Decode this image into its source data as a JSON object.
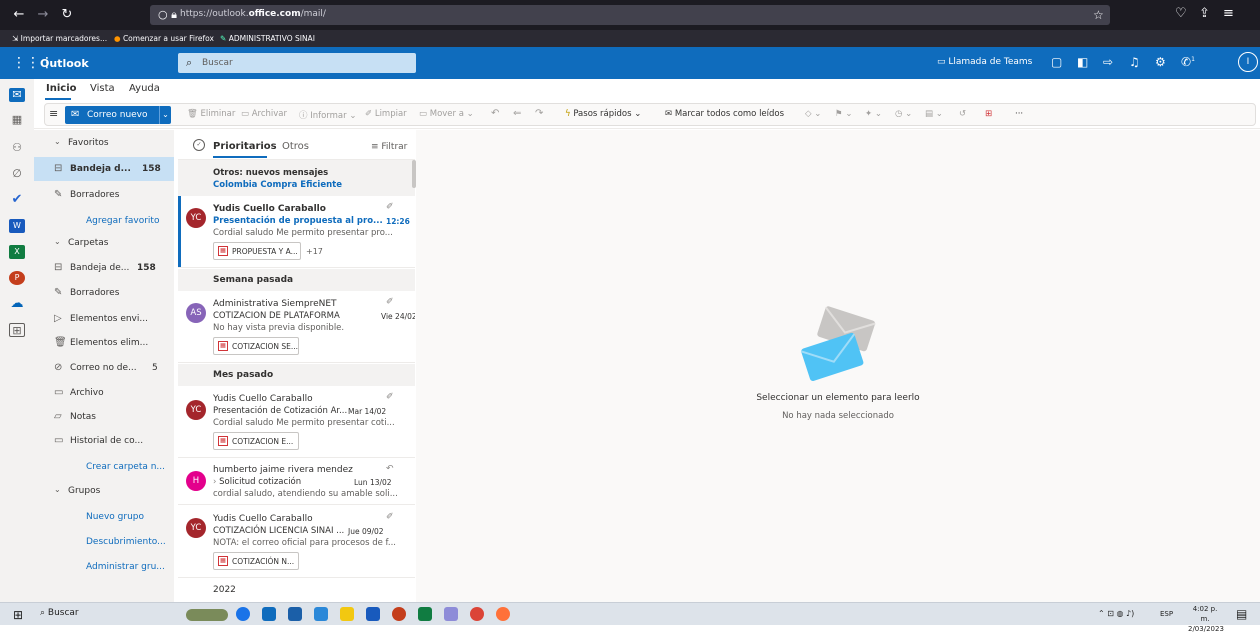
{
  "browser": {
    "url_host_prefix": "https://outlook.",
    "url_host_bold": "office.com",
    "url_path": "/mail/",
    "bookmarks": [
      "Importar marcadores...",
      "Comenzar a usar Firefox",
      "ADMINISTRATIVO SINAI"
    ]
  },
  "header": {
    "app_name": "Outlook",
    "search_placeholder": "Buscar",
    "teams_label": "Llamada de Teams",
    "user_initial": "I",
    "notification_badge": "1"
  },
  "ribbon": {
    "tabs": [
      "Inicio",
      "Vista",
      "Ayuda"
    ],
    "new_mail": "Correo nuevo",
    "actions": {
      "delete": "Eliminar",
      "archive": "Archivar",
      "report": "Informar",
      "sweep": "Limpiar",
      "move": "Mover a",
      "quick_steps": "Pasos rápidos",
      "mark_all_read": "Marcar todos como leídos"
    }
  },
  "folders": {
    "favorites_label": "Favoritos",
    "favorites": [
      {
        "label": "Bandeja d...",
        "count": "158"
      },
      {
        "label": "Borradores"
      }
    ],
    "add_favorite": "Agregar favorito",
    "folders_label": "Carpetas",
    "items": [
      {
        "label": "Bandeja de...",
        "count": "158"
      },
      {
        "label": "Borradores"
      },
      {
        "label": "Elementos envi..."
      },
      {
        "label": "Elementos elim..."
      },
      {
        "label": "Correo no de...",
        "count": "5"
      },
      {
        "label": "Archivo"
      },
      {
        "label": "Notas"
      },
      {
        "label": "Historial de co..."
      }
    ],
    "create_folder": "Crear carpeta n...",
    "groups_label": "Grupos",
    "group_links": [
      "Nuevo grupo",
      "Descubrimiento...",
      "Administrar gru..."
    ]
  },
  "list": {
    "tab_focused": "Prioritarios",
    "tab_others": "Otros",
    "filter": "Filtrar",
    "others_banner_title": "Otros: nuevos mensajes",
    "others_banner_sender": "Colombia Compra Eficiente",
    "groups": [
      "Semana pasada",
      "Mes pasado",
      "2022"
    ],
    "messages": [
      {
        "initials": "YC",
        "from": "Yudis Cuello Caraballo",
        "subject": "Presentación de propuesta al pro...",
        "date": "12:26",
        "preview": "Cordial saludo Me permito presentar pro...",
        "attachment": "PROPUESTA Y A...",
        "more": "+17"
      },
      {
        "initials": "AS",
        "from": "Administrativa SiempreNET",
        "subject": "COTIZACION DE PLATAFORMA",
        "date": "Vie 24/02",
        "preview": "No hay vista previa disponible.",
        "attachment": "COTIZACION SE..."
      },
      {
        "initials": "YC",
        "from": "Yudis Cuello Caraballo",
        "subject": "Presentación de Cotización Ar...",
        "date": "Mar 14/02",
        "preview": "Cordial saludo Me permito presentar coti...",
        "attachment": "COTIZACION E..."
      },
      {
        "initials": "H",
        "from": "humberto jaime rivera mendez",
        "subject": "Solicitud cotización",
        "date": "Lun 13/02",
        "preview": "cordial saludo, atendiendo su amable soli..."
      },
      {
        "initials": "YC",
        "from": "Yudis Cuello Caraballo",
        "subject": "COTIZACIÓN LICENCIA SINAI ...",
        "date": "Jue 09/02",
        "preview": "NOTA: el correo oficial para procesos de f...",
        "attachment": "COTIZACIÓN N..."
      }
    ]
  },
  "reading": {
    "title": "Seleccionar un elemento para leerlo",
    "subtitle": "No hay nada seleccionado"
  },
  "taskbar": {
    "search": "Buscar",
    "lang": "ESP",
    "time": "4:02 p. m.",
    "date": "2/03/2023"
  },
  "colors": {
    "brand": "#0f6cbd",
    "avatar_yc": "#a4262c",
    "avatar_as": "#8764b8",
    "avatar_h": "#e3008c"
  }
}
